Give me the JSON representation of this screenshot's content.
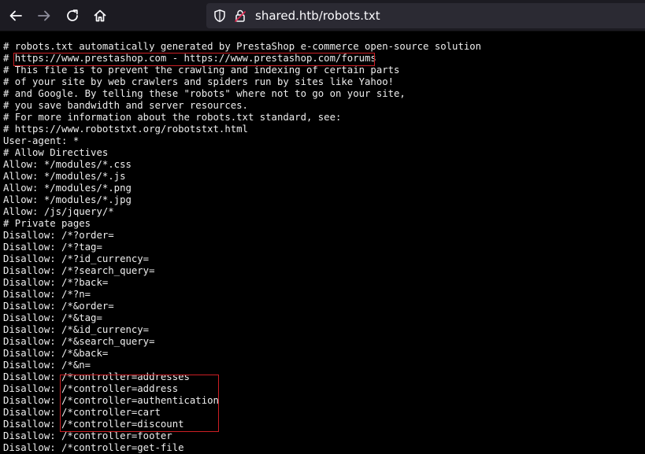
{
  "browser": {
    "url": "shared.htb/robots.txt",
    "icons": {
      "back": "arrow-left-icon",
      "forward": "arrow-right-icon",
      "reload": "reload-icon",
      "home": "home-icon",
      "tracking": "shield-icon",
      "site": "lock-icon"
    }
  },
  "file": {
    "lines": [
      "# robots.txt automatically generated by PrestaShop e-commerce open-source solution",
      "# https://www.prestashop.com - https://www.prestashop.com/forums",
      "# This file is to prevent the crawling and indexing of certain parts",
      "# of your site by web crawlers and spiders run by sites like Yahoo!",
      "# and Google. By telling these \"robots\" where not to go on your site,",
      "# you save bandwidth and server resources.",
      "# For more information about the robots.txt standard, see:",
      "# https://www.robotstxt.org/robotstxt.html",
      "User-agent: *",
      "# Allow Directives",
      "Allow: */modules/*.css",
      "Allow: */modules/*.js",
      "Allow: */modules/*.png",
      "Allow: */modules/*.jpg",
      "Allow: /js/jquery/*",
      "# Private pages",
      "Disallow: /*?order=",
      "Disallow: /*?tag=",
      "Disallow: /*?id_currency=",
      "Disallow: /*?search_query=",
      "Disallow: /*?back=",
      "Disallow: /*?n=",
      "Disallow: /*&order=",
      "Disallow: /*&tag=",
      "Disallow: /*&id_currency=",
      "Disallow: /*&search_query=",
      "Disallow: /*&back=",
      "Disallow: /*&n=",
      "Disallow: /*controller=addresses",
      "Disallow: /*controller=address",
      "Disallow: /*controller=authentication",
      "Disallow: /*controller=cart",
      "Disallow: /*controller=discount",
      "Disallow: /*controller=footer",
      "Disallow: /*controller=get-file"
    ]
  },
  "colors": {
    "highlight": "#cc1f24",
    "text": "#eeeeee",
    "background": "#000000",
    "toolbar": "#1c1b22"
  }
}
